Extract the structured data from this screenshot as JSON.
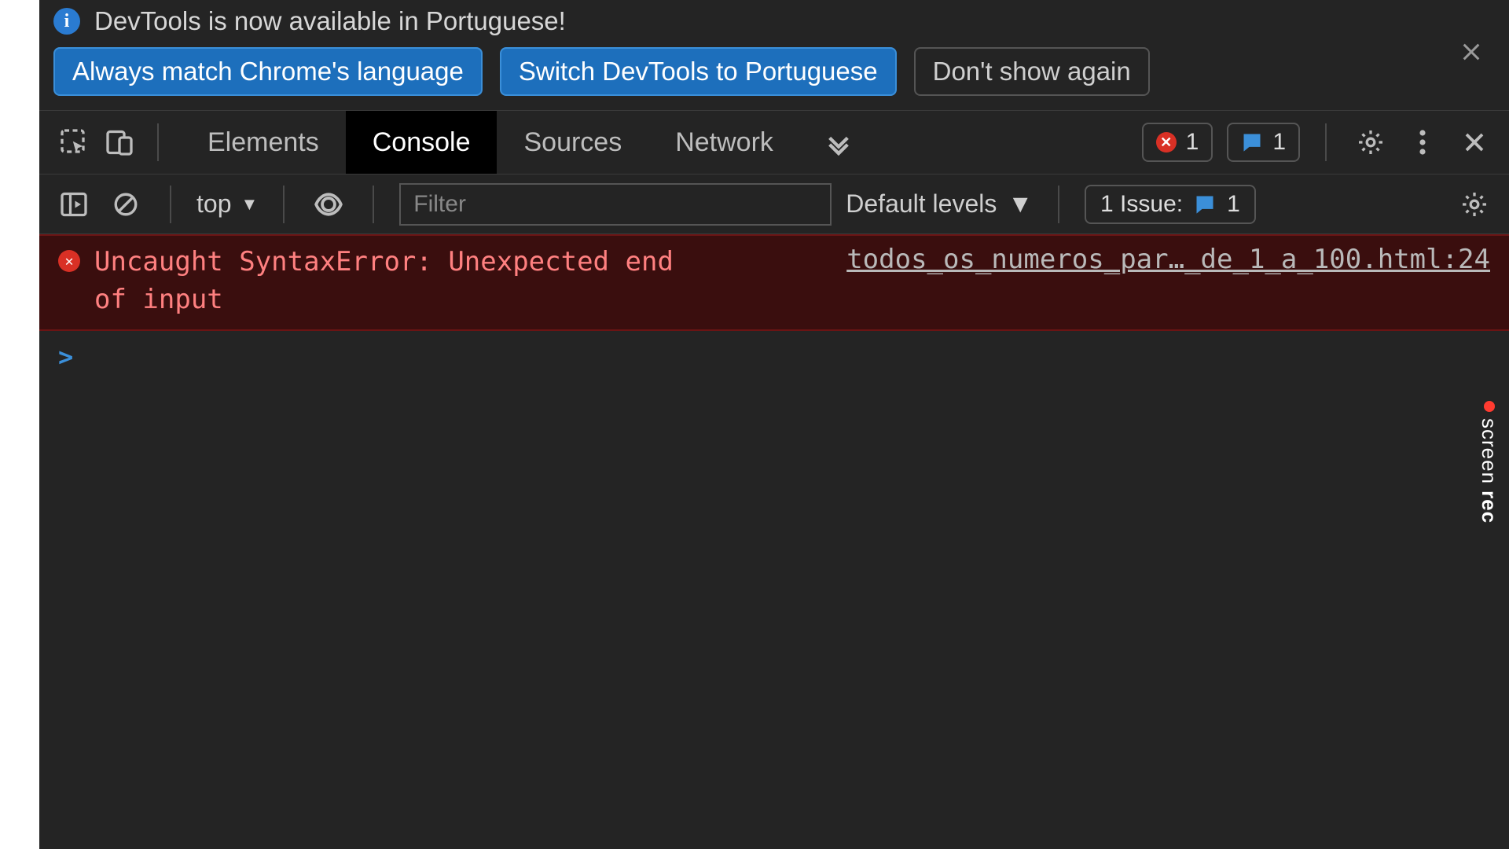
{
  "infobar": {
    "title": "DevTools is now available in Portuguese!",
    "match_btn": "Always match Chrome's language",
    "switch_btn": "Switch DevTools to Portuguese",
    "dismiss_btn": "Don't show again"
  },
  "tabs": {
    "elements": "Elements",
    "console": "Console",
    "sources": "Sources",
    "network": "Network"
  },
  "counts": {
    "errors": "1",
    "messages": "1"
  },
  "console_toolbar": {
    "context": "top",
    "filter_placeholder": "Filter",
    "levels": "Default levels",
    "issues_label": "1 Issue:",
    "issues_count": "1"
  },
  "error": {
    "message": "Uncaught SyntaxError: Unexpected end of input",
    "source": "todos_os_numeros_par…_de_1_a_100.html:24"
  },
  "watermark": {
    "a": "screen",
    "b": "rec"
  }
}
